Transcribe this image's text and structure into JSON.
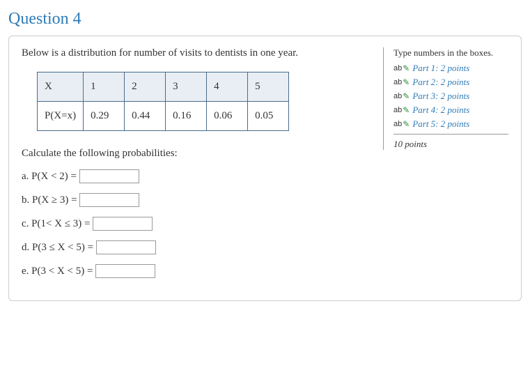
{
  "title": "Question 4",
  "prompt": "Below is a distribution for number of visits to dentists in one year.",
  "table": {
    "r1": [
      "X",
      "1",
      "2",
      "3",
      "4",
      "5"
    ],
    "r2": [
      "P(X=x)",
      "0.29",
      "0.44",
      "0.16",
      "0.06",
      "0.05"
    ]
  },
  "calc_prompt": "Calculate the following probabilities:",
  "items": {
    "a": "a. P(X < 2) =",
    "b": "b. P(X ≥ 3) =",
    "c": "c. P(1< X ≤ 3) =",
    "d": "d. P(3 ≤ X < 5) =",
    "e": "e. P(3 < X < 5) ="
  },
  "side": {
    "hint": "Type numbers in the boxes.",
    "parts": {
      "p1": "Part 1: 2 points",
      "p2": "Part 2: 2 points",
      "p3": "Part 3: 2 points",
      "p4": "Part 4: 2 points",
      "p5": "Part 5: 2 points"
    },
    "total": "10 points"
  }
}
